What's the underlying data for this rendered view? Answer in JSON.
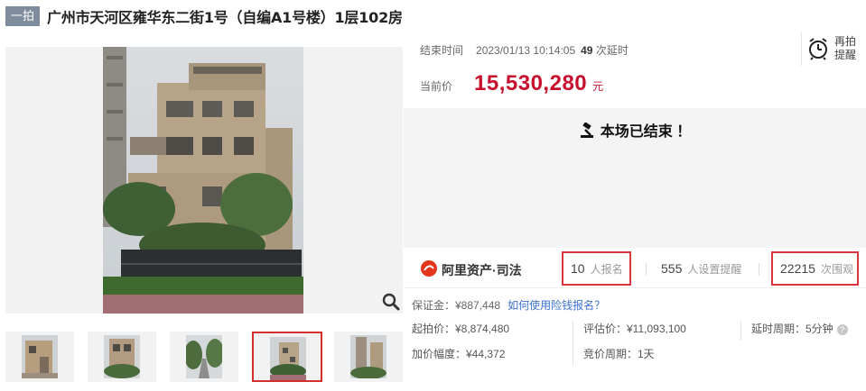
{
  "header": {
    "badge": "一拍",
    "title": "广州市天河区雍华东二街1号（自编A1号楼）1层102房"
  },
  "auction": {
    "end_label": "结束时间",
    "end_time": "2023/01/13 10:14:05",
    "delay_count": "49",
    "delay_suffix": "次延时",
    "remind_line1": "再拍",
    "remind_line2": "提醒",
    "price_label": "当前价",
    "price": "15,530,280",
    "price_unit": "元",
    "ended_text": "本场已结束 ！"
  },
  "stats": {
    "logo_text": "阿里资产·司法",
    "signups": "10",
    "signups_unit": "人报名",
    "reminders": "555",
    "reminders_unit": "人设置提醒",
    "views": "22215",
    "views_unit": "次围观"
  },
  "deposit": {
    "label": "保证金：¥887,448",
    "link": "如何使用险钱报名？"
  },
  "details": {
    "start_price": "起拍价：¥8,874,480",
    "appraisal": "评估价：¥11,093,100",
    "delay_cycle": "延时周期：5分钟",
    "increment": "加价幅度：¥44,372",
    "bid_cycle": "竞价周期：1天"
  },
  "colors": {
    "accent_red": "#c8102e",
    "highlight_box": "#d9363e",
    "link_blue": "#3a6fcf",
    "badge_bg": "#7f8c9d"
  },
  "icons": [
    "alarm-clock-icon",
    "gavel-icon",
    "magnifier-icon",
    "help-icon",
    "alibaba-logo-icon"
  ]
}
